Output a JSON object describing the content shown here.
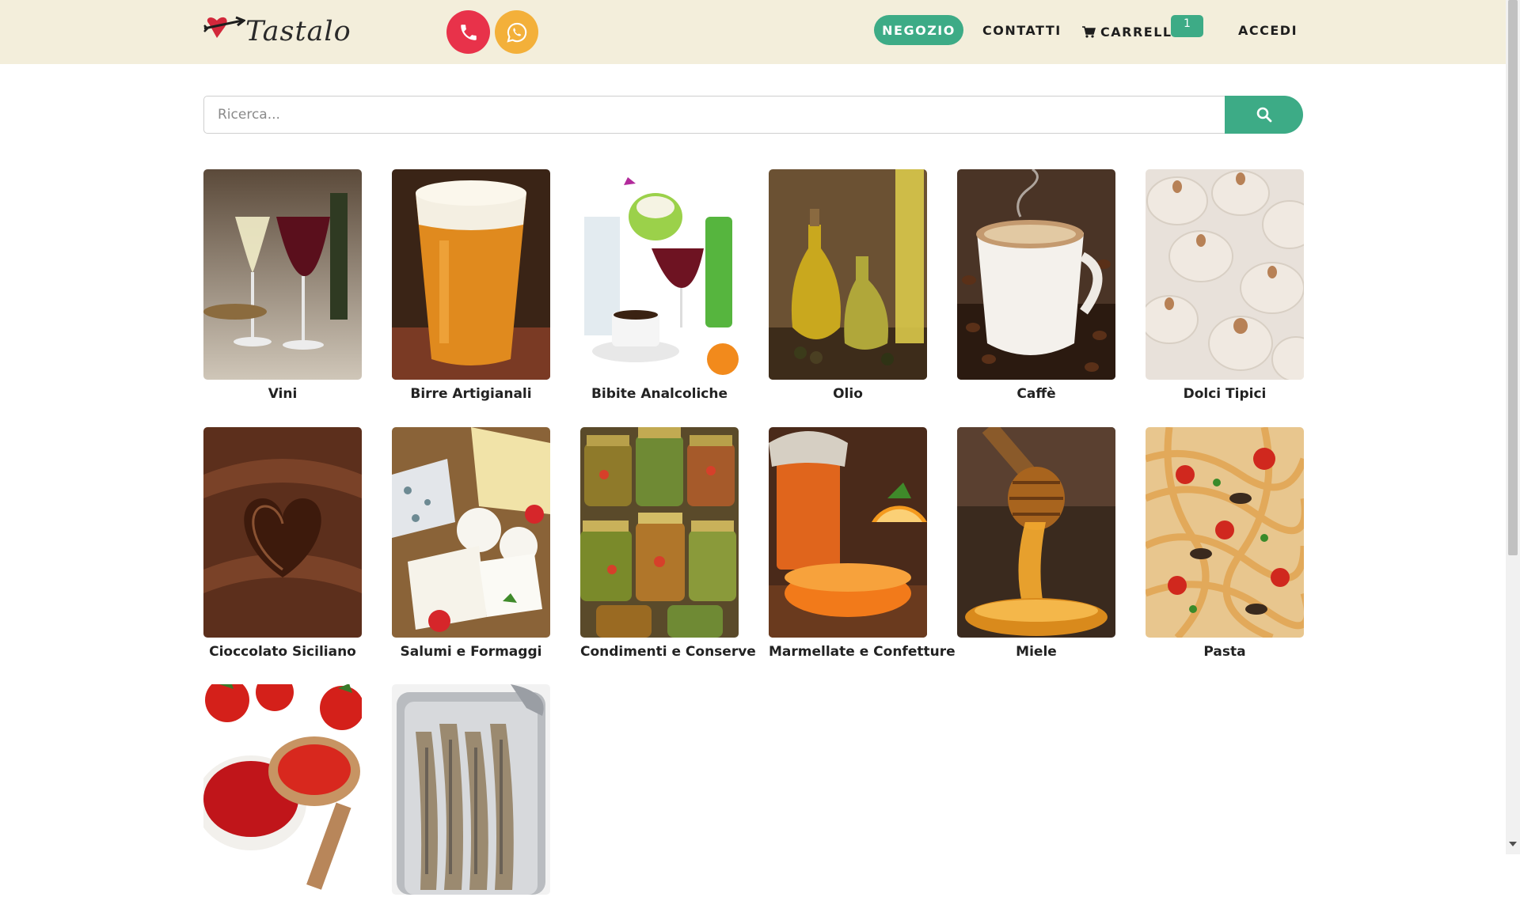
{
  "brand": {
    "name": "Tastalo"
  },
  "header": {
    "call_icon": "phone-icon",
    "whatsapp_icon": "whatsapp-icon",
    "nav": {
      "shop": "NEGOZIO",
      "contacts": "CONTATTI",
      "cart": "CARRELLO",
      "cart_count": "1",
      "login": "ACCEDI"
    }
  },
  "search": {
    "placeholder": "Ricerca...",
    "value": "",
    "icon": "search-icon"
  },
  "categories": [
    {
      "label": "Vini"
    },
    {
      "label": "Birre Artigianali"
    },
    {
      "label": "Bibite Analcoliche"
    },
    {
      "label": "Olio"
    },
    {
      "label": "Caffè"
    },
    {
      "label": "Dolci Tipici"
    },
    {
      "label": "Cioccolato Siciliano"
    },
    {
      "label": "Salumi e Formaggi"
    },
    {
      "label": "Condimenti e Conserve"
    },
    {
      "label": "Marmellate e Confetture"
    },
    {
      "label": "Miele"
    },
    {
      "label": "Pasta"
    },
    {
      "label": ""
    },
    {
      "label": ""
    }
  ],
  "colors": {
    "header_bg": "#f3eedb",
    "accent_green": "#3dab86",
    "call_red": "#e8324a",
    "whatsapp_orange": "#f3b03a"
  }
}
